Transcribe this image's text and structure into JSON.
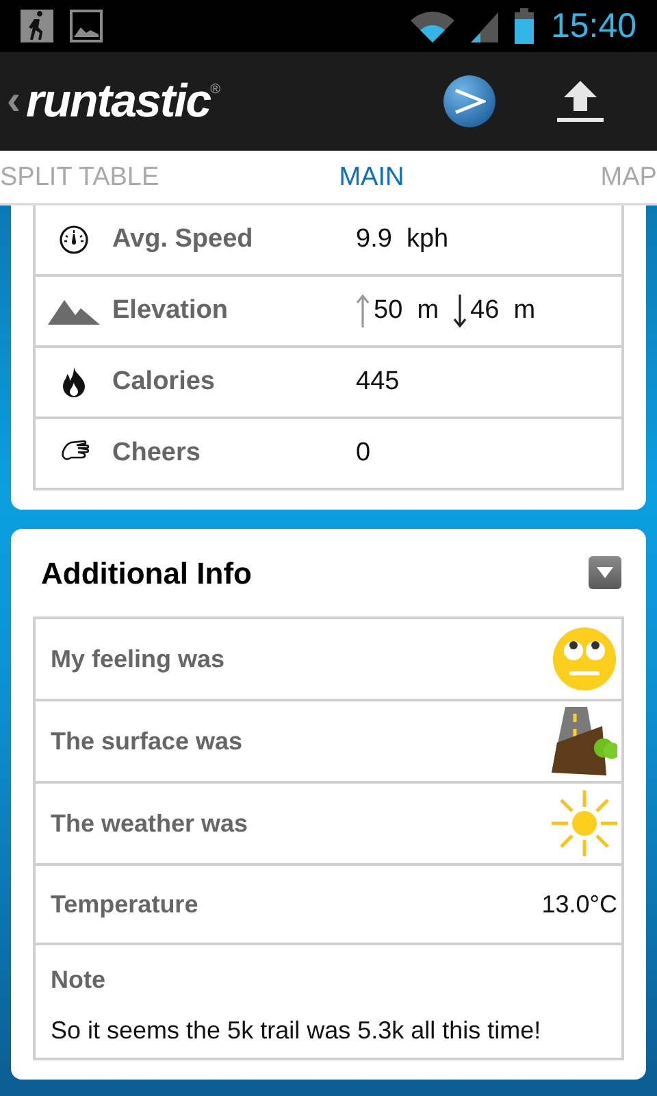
{
  "status_bar": {
    "time": "15:40"
  },
  "action_bar": {
    "back": "‹",
    "logo": "runtastic",
    "logo_mark": "®"
  },
  "tabs": [
    {
      "label": "SPLIT TABLE",
      "selected": false
    },
    {
      "label": "MAIN",
      "selected": true
    },
    {
      "label": "MAP",
      "selected": false
    }
  ],
  "stats": [
    {
      "kind": "speed",
      "label": "Avg. Speed",
      "value": "9.9  kph"
    },
    {
      "kind": "elevation",
      "label": "Elevation",
      "up": "50  m",
      "down": "46  m"
    },
    {
      "kind": "calories",
      "label": "Calories",
      "value": "445"
    },
    {
      "kind": "cheers",
      "label": "Cheers",
      "value": "0"
    }
  ],
  "additional_info": {
    "title": "Additional Info",
    "expanded": true,
    "rows": [
      {
        "kind": "feeling",
        "label": "My feeling was"
      },
      {
        "kind": "surface",
        "label": "The surface was"
      },
      {
        "kind": "weather",
        "label": "The weather was"
      },
      {
        "kind": "text",
        "label": "Temperature",
        "value": "13.0°C"
      },
      {
        "kind": "note",
        "label": "Note",
        "value": "So it seems the 5k trail was 5.3k all this time!"
      }
    ]
  }
}
